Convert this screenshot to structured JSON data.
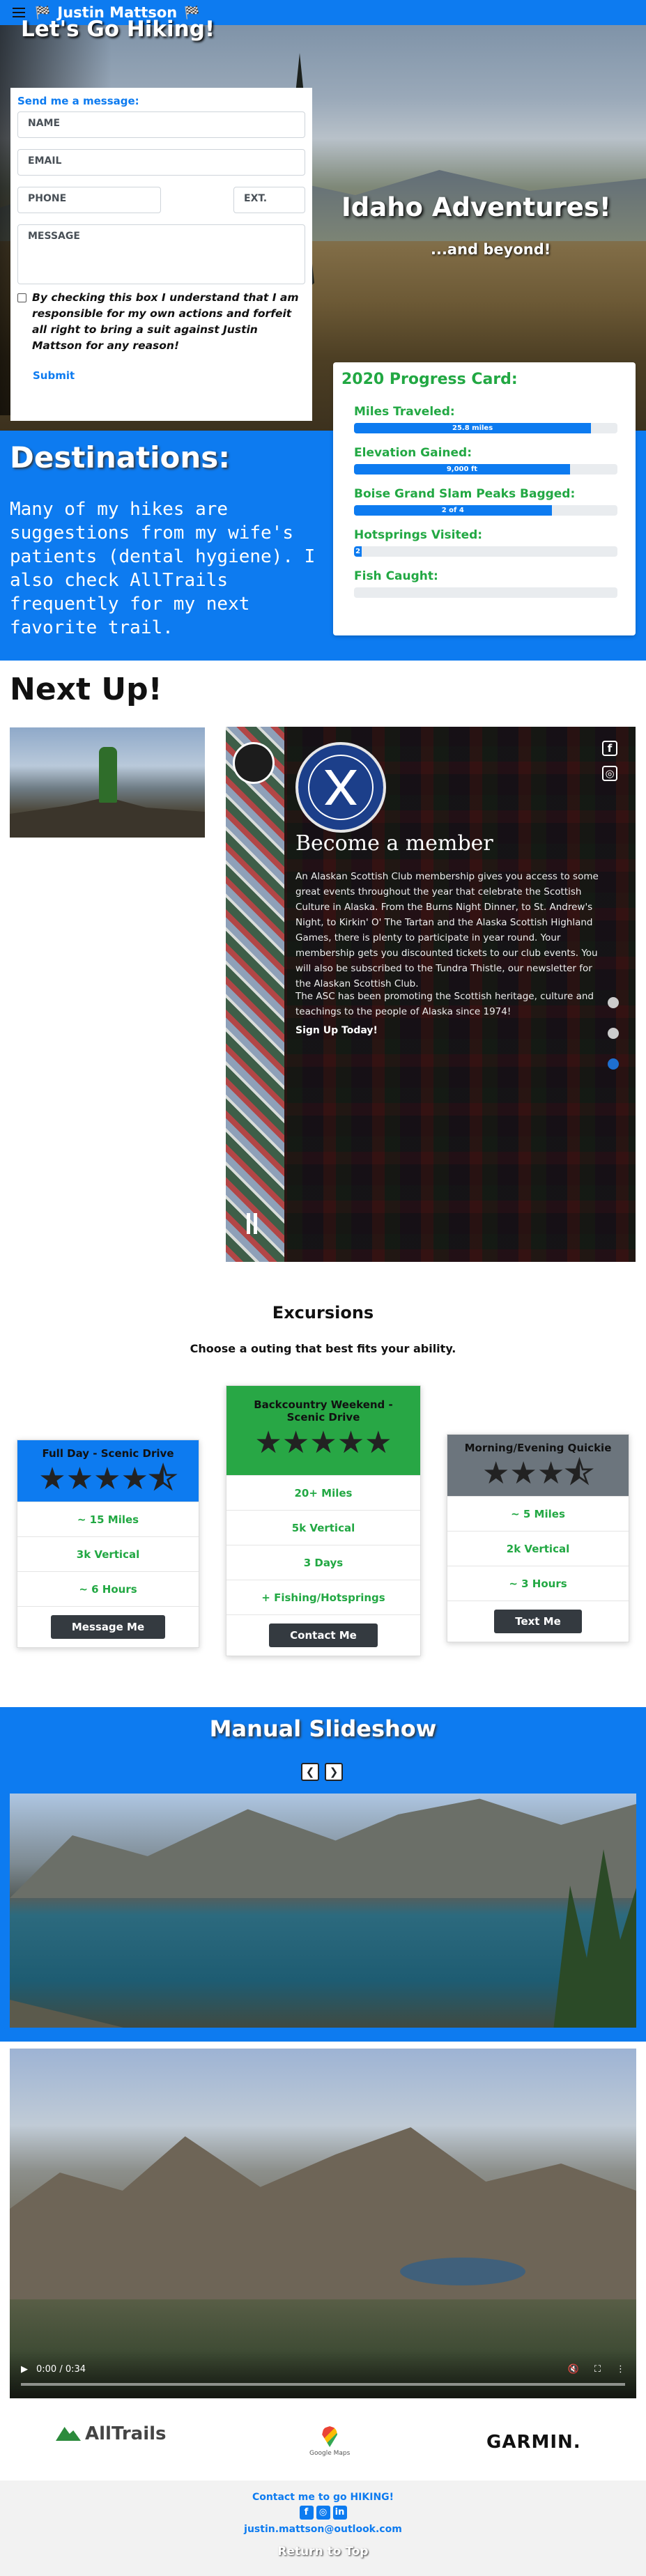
{
  "nav": {
    "brand": "Justin Mattson",
    "flag_left": "🏁",
    "flag_right": "🏁"
  },
  "hero": {
    "title": "Let's Go Hiking!",
    "headline": "Idaho Adventures!",
    "subheadline": "...and beyond!"
  },
  "form": {
    "heading": "Send me a message:",
    "name_placeholder": "NAME",
    "email_placeholder": "EMAIL",
    "phone_placeholder": "PHONE",
    "ext_placeholder": "EXT.",
    "message_placeholder": "MESSAGE",
    "consent": "By checking this box I understand that I am responsible for my own actions and forfeit all right to bring a suit against Justin Mattson for any reason!",
    "submit": "Submit"
  },
  "destinations": {
    "title": "Destinations:",
    "text": "Many of my hikes are suggestions from my wife's patients (dental hygiene). I also check AllTrails frequently for my next favorite trail."
  },
  "progress": {
    "title": "2020 Progress Card:",
    "items": [
      {
        "label": "Miles Traveled:",
        "text": "25.8 miles",
        "fraction": 0.9
      },
      {
        "label": "Elevation Gained:",
        "text": "9,000 ft",
        "fraction": 0.82
      },
      {
        "label": "Boise Grand Slam Peaks Bagged:",
        "text": "2 of 4",
        "fraction": 0.75
      },
      {
        "label": "Hotsprings Visited:",
        "text": "2",
        "fraction": 0.03
      },
      {
        "label": "Fish Caught:",
        "text": "",
        "fraction": 0
      }
    ]
  },
  "next": {
    "title": "Next Up!"
  },
  "carousel": {
    "heading": "Become a member",
    "p1": "An Alaskan Scottish Club membership gives you access to some great events throughout the year that celebrate the Scottish Culture in Alaska. From the Burns Night Dinner, to St. Andrew's Night, to Kirkin' O' The Tartan and the Alaska Scottish Highland Games, there is plenty to participate in year round. Your membership gets you discounted tickets to our club events. You will also be subscribed to the Tundra Thistle, our newsletter for the Alaskan Scottish Club.",
    "p2": "The ASC has been promoting the Scottish heritage, culture and teachings to the people of Alaska since 1974!",
    "cta": "Sign Up Today!",
    "social": [
      "f",
      "◎"
    ]
  },
  "excursions": {
    "title": "Excursions",
    "subtitle": "Choose a outing that best fits your ability.",
    "cards": [
      {
        "title": "Full Day - Scenic Drive",
        "stars": "★★★★⯪",
        "items": [
          "~ 15 Miles",
          "3k Vertical",
          "~ 6 Hours"
        ],
        "button": "Message Me",
        "color": "#0d7bf0"
      },
      {
        "title": "Backcountry Weekend - Scenic Drive",
        "stars": "★★★★★",
        "items": [
          "20+ Miles",
          "5k Vertical",
          "3 Days",
          "+ Fishing/Hotsprings"
        ],
        "button": "Contact Me",
        "color": "#28a745"
      },
      {
        "title": "Morning/Evening Quickie",
        "stars": "★★★⯪",
        "items": [
          "~ 5 Miles",
          "2k Vertical",
          "~ 3 Hours"
        ],
        "button": "Text Me",
        "color": "#6c757d"
      }
    ]
  },
  "slideshow": {
    "title": "Manual Slideshow",
    "prev": "❮",
    "next": "❯"
  },
  "video": {
    "time": "0:00 / 0:34"
  },
  "logos": {
    "alltrails": "AllTrails",
    "google": "Google Maps",
    "garmin": "GARMIN."
  },
  "footer": {
    "contact": "Contact me to go HIKING!",
    "email": "justin.mattson@outlook.com",
    "top": "Return to Top",
    "icons": [
      "f",
      "◎",
      "in"
    ]
  }
}
